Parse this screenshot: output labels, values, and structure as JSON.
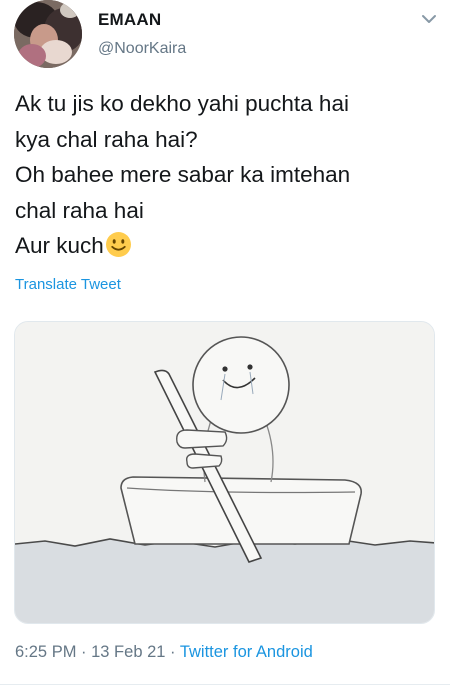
{
  "user": {
    "display_name": "EMAAN",
    "handle": "@NoorKaira"
  },
  "tweet": {
    "lines": [
      "Ak tu jis ko dekho yahi puchta hai",
      "kya chal raha hai?",
      "Oh bahee mere sabar ka imtehan",
      "chal raha hai",
      "Aur kuch"
    ],
    "emoji": "slightly-smiling-face"
  },
  "translate_label": "Translate Tweet",
  "meta": {
    "time": "6:25 PM",
    "separator1": " · ",
    "date": "13 Feb 21",
    "separator2": " · ",
    "source": "Twitter for Android"
  },
  "icons": {
    "menu": "chevron-down-icon",
    "emoji": "smiley-emoji-icon"
  },
  "colors": {
    "link": "#1b95e0",
    "secondary_text": "#657786",
    "primary_text": "#14171a"
  }
}
